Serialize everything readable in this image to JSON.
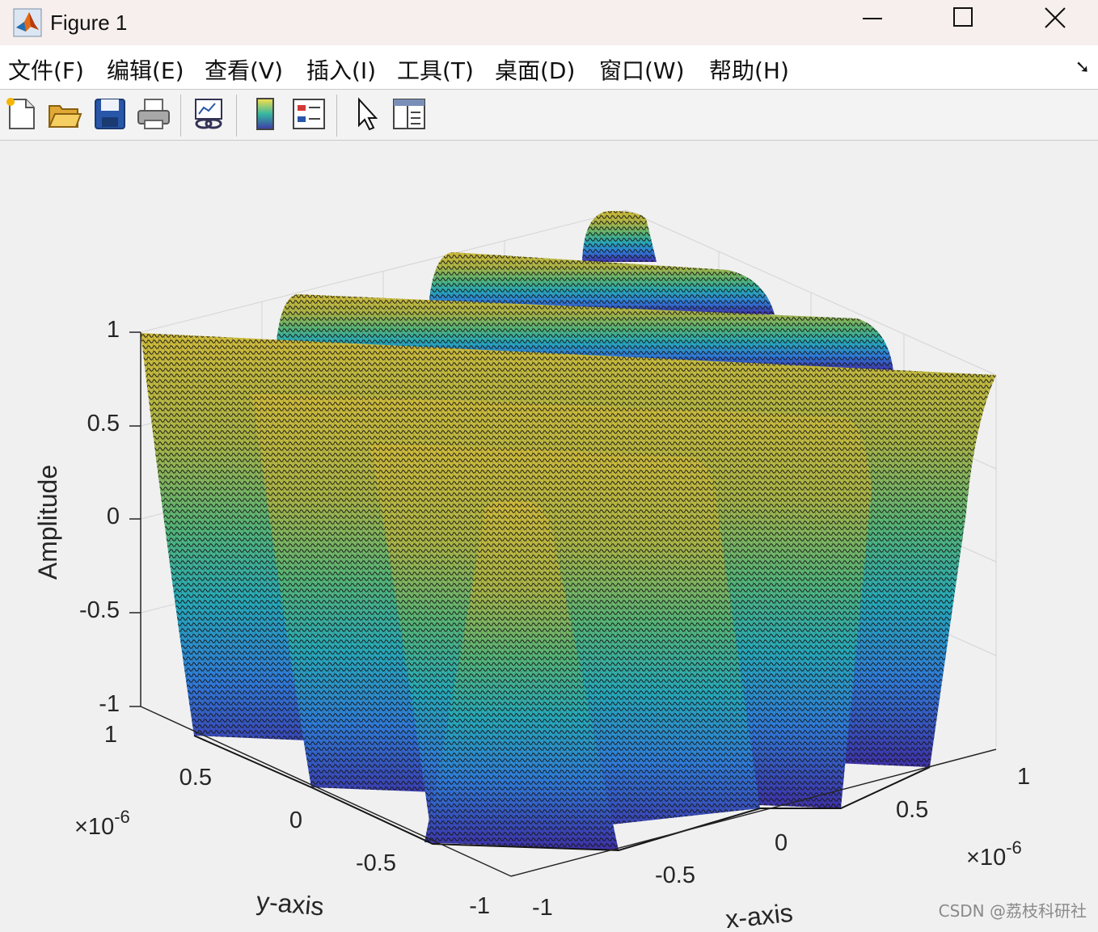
{
  "window": {
    "title": "Figure 1"
  },
  "menu": [
    "文件(F)",
    "编辑(E)",
    "查看(V)",
    "插入(I)",
    "工具(T)",
    "桌面(D)",
    "窗口(W)",
    "帮助(H)"
  ],
  "toolbar": {
    "buttons": [
      "new-figure-icon",
      "open-file-icon",
      "save-icon",
      "print-icon",
      "link-plot-icon",
      "colorbar-icon",
      "legend-icon",
      "pointer-icon",
      "property-inspector-icon"
    ]
  },
  "chart_data": {
    "type": "surface",
    "xlabel": "x-axis",
    "ylabel": "y-axis",
    "zlabel": "Amplitude",
    "x_multiplier": "×10",
    "x_multiplier_exp": "-6",
    "y_multiplier": "×10",
    "y_multiplier_exp": "-6",
    "xlim": [
      -1e-06,
      1e-06
    ],
    "ylim": [
      -1e-06,
      1e-06
    ],
    "zlim": [
      -1,
      1
    ],
    "x_ticks": [
      "-1",
      "-0.5",
      "0",
      "0.5",
      "1"
    ],
    "y_ticks": [
      "-1",
      "-0.5",
      "0",
      "0.5",
      "1"
    ],
    "z_ticks": [
      "-1",
      "-0.5",
      "0",
      "0.5",
      "1"
    ],
    "grid": true,
    "colormap": "parula"
  },
  "watermark": "CSDN @荔枝科研社"
}
